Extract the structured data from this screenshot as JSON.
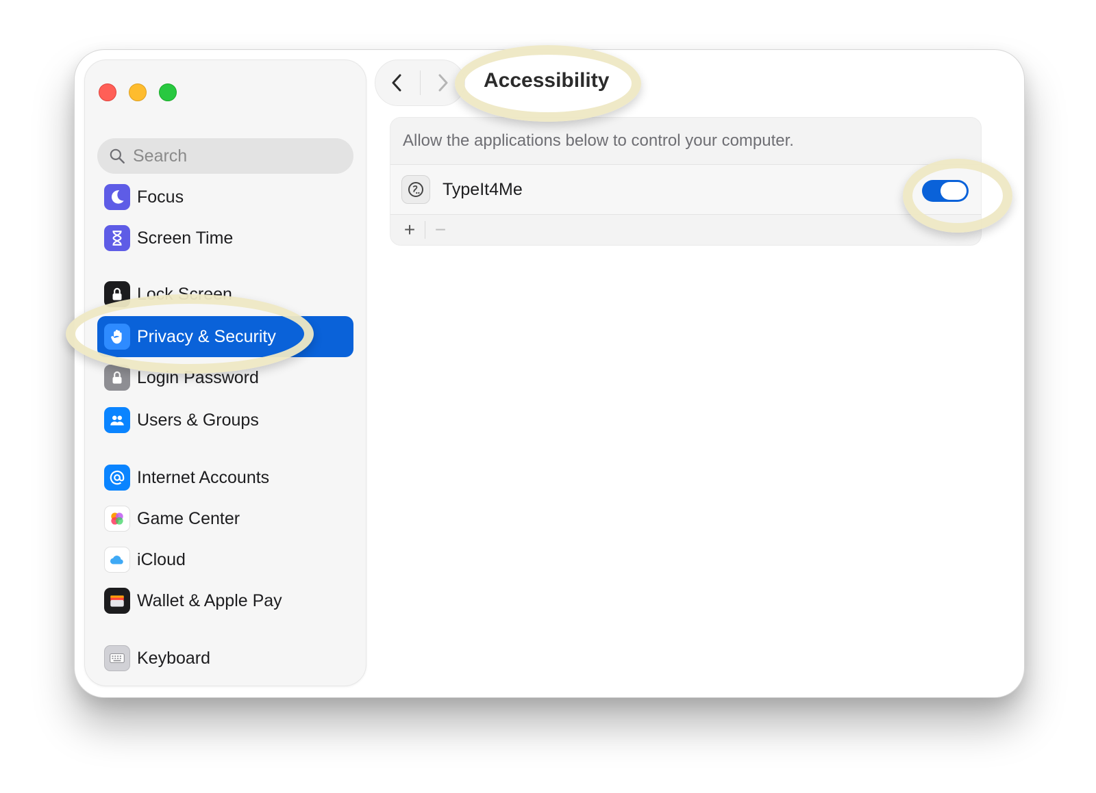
{
  "window": {
    "traffic_lights": [
      "close",
      "minimize",
      "zoom"
    ]
  },
  "sidebar": {
    "search_placeholder": "Search",
    "items": [
      {
        "label": "Focus",
        "icon": "moon-icon",
        "color": "#5e5ce6"
      },
      {
        "label": "Screen Time",
        "icon": "hourglass-icon",
        "color": "#5e5ce6"
      },
      {
        "label": "Lock Screen",
        "icon": "lock-icon",
        "color": "#1c1c1e"
      },
      {
        "label": "Privacy & Security",
        "icon": "hand-icon",
        "color": "#0a84ff",
        "selected": true
      },
      {
        "label": "Login Password",
        "icon": "lock-icon",
        "color": "#8e8e93"
      },
      {
        "label": "Users & Groups",
        "icon": "users-icon",
        "color": "#0a84ff"
      },
      {
        "label": "Internet Accounts",
        "icon": "at-sign-icon",
        "color": "#0a84ff"
      },
      {
        "label": "Game Center",
        "icon": "game-center-icon",
        "color": "#ff375f"
      },
      {
        "label": "iCloud",
        "icon": "cloud-icon",
        "color": "#3fa9f5"
      },
      {
        "label": "Wallet & Apple Pay",
        "icon": "wallet-icon",
        "color": "#1c1c1e"
      },
      {
        "label": "Keyboard",
        "icon": "keyboard-icon",
        "color": "#8e8e93"
      }
    ]
  },
  "toolbar": {
    "title": "Accessibility"
  },
  "content": {
    "description": "Allow the applications below to control your computer.",
    "apps": [
      {
        "name": "TypeIt4Me",
        "enabled": true
      }
    ],
    "add_label": "+",
    "remove_label": "−"
  },
  "colors": {
    "accent": "#0a62d9",
    "highlight": "#eee8c4"
  }
}
